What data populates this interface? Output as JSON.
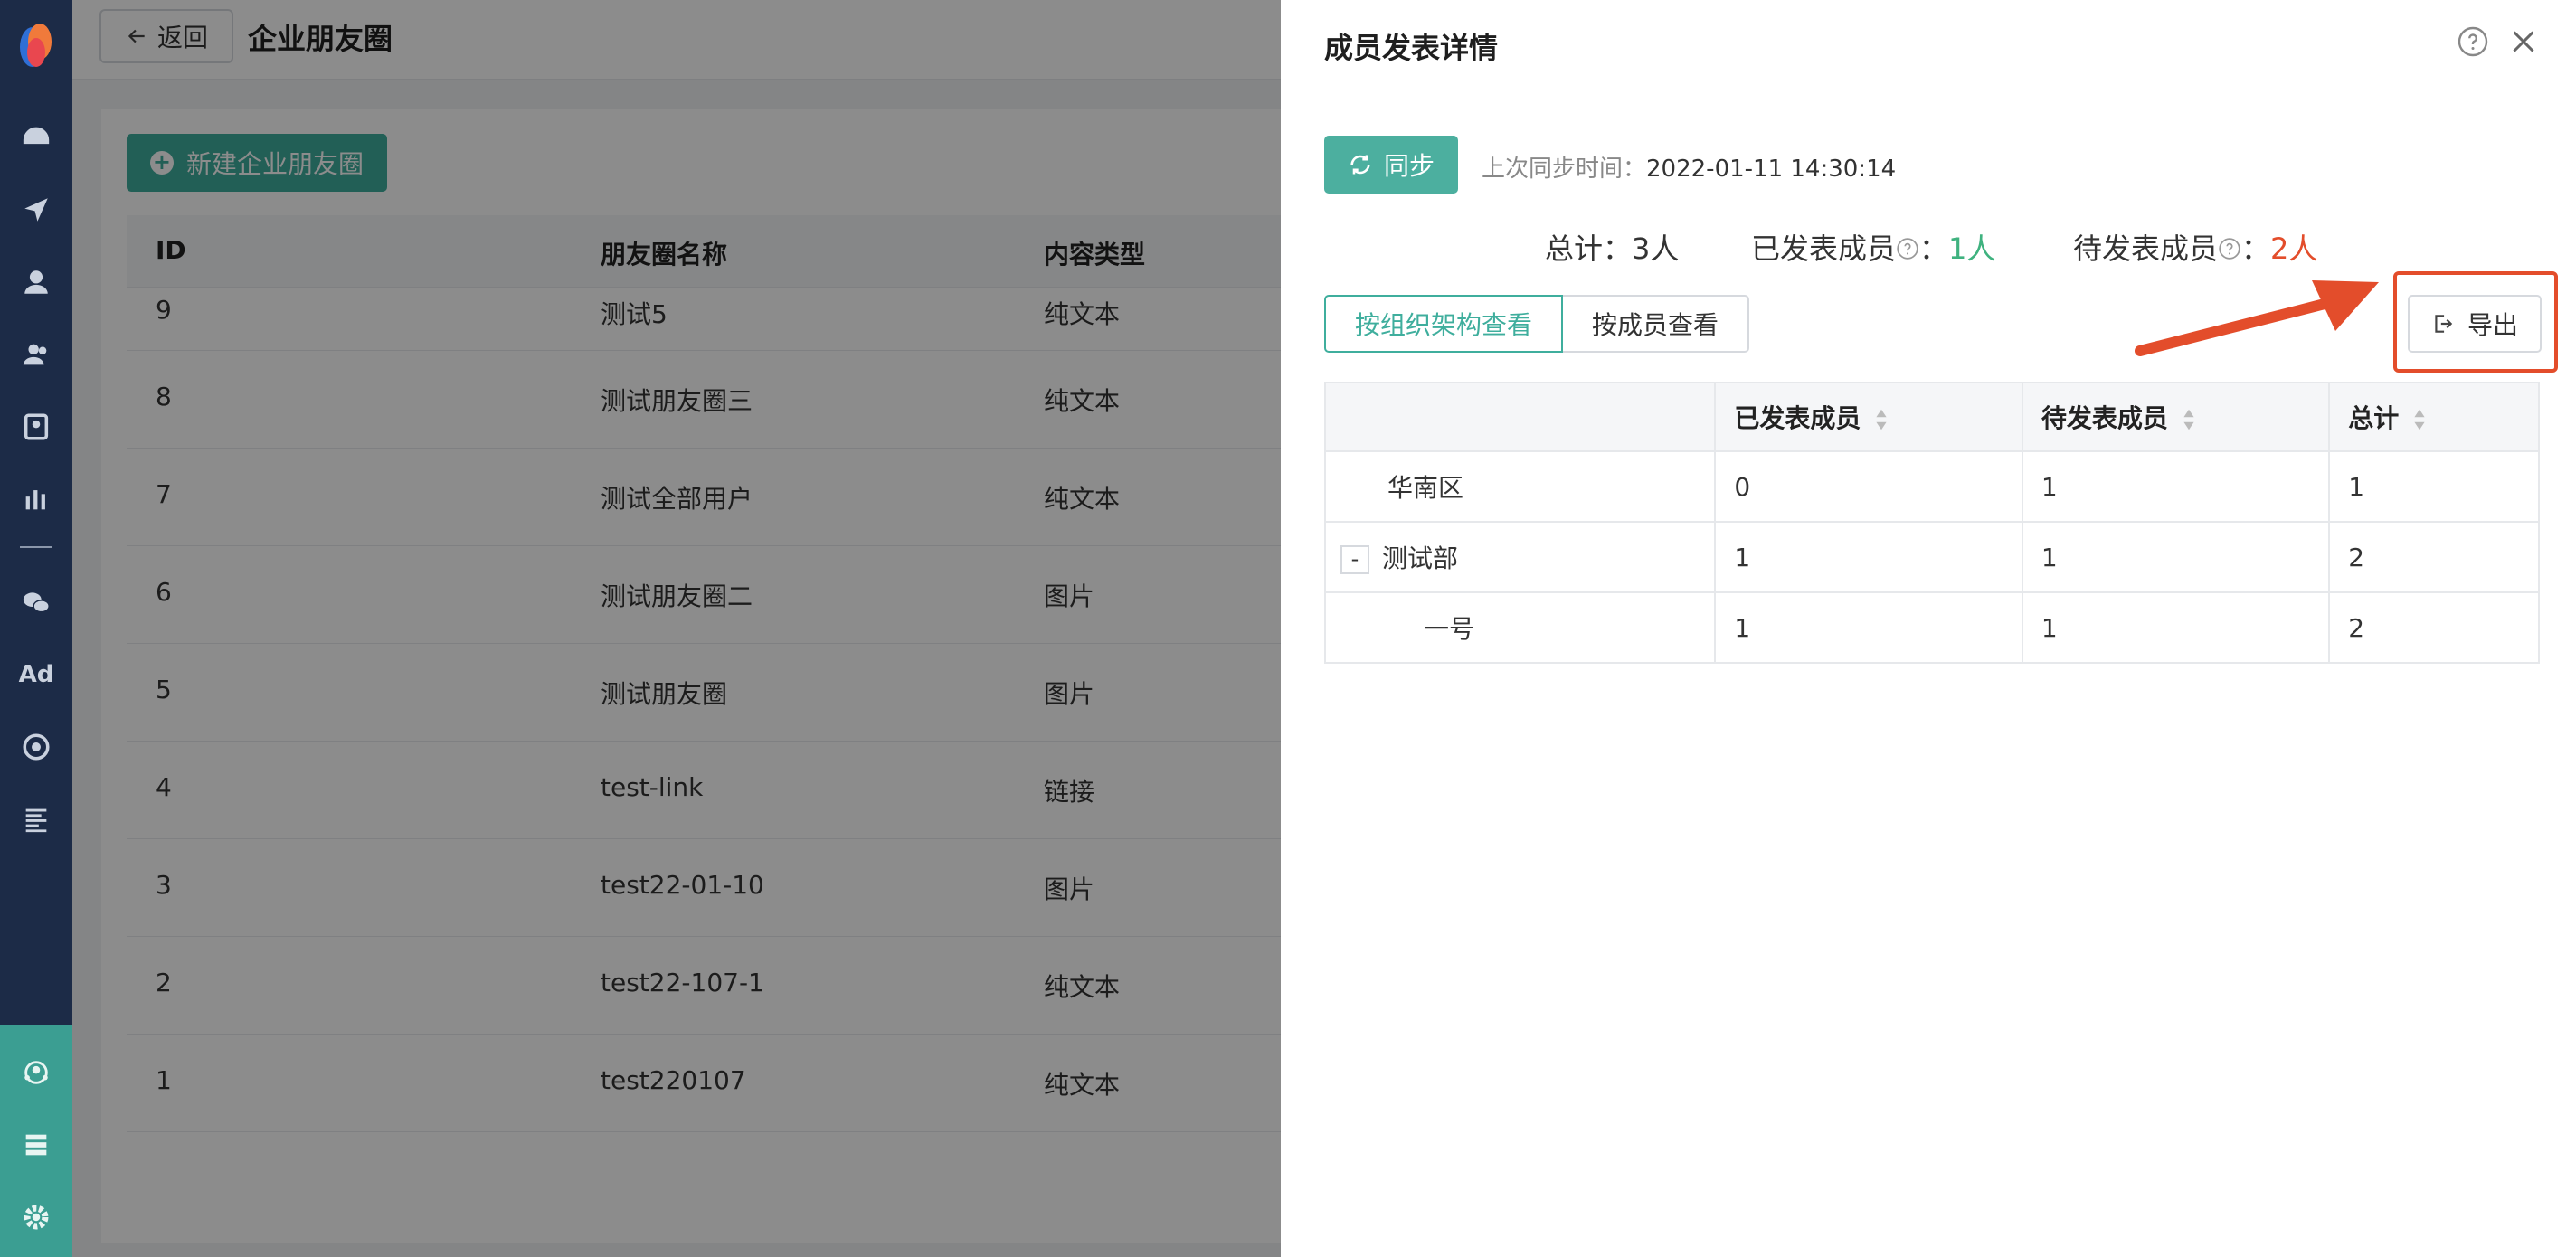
{
  "topbar": {
    "back_label": "返回",
    "page_title": "企业朋友圈"
  },
  "content": {
    "new_button_label": "新建企业朋友圈",
    "columns": [
      "ID",
      "朋友圈名称",
      "内容类型"
    ],
    "rows": [
      {
        "id": "9",
        "name": "测试5",
        "type": "纯文本"
      },
      {
        "id": "8",
        "name": "测试朋友圈三",
        "type": "纯文本"
      },
      {
        "id": "7",
        "name": "测试全部用户",
        "type": "纯文本"
      },
      {
        "id": "6",
        "name": "测试朋友圈二",
        "type": "图片"
      },
      {
        "id": "5",
        "name": "测试朋友圈",
        "type": "图片"
      },
      {
        "id": "4",
        "name": "test-link",
        "type": "链接"
      },
      {
        "id": "3",
        "name": "test22-01-10",
        "type": "图片"
      },
      {
        "id": "2",
        "name": "test22-107-1",
        "type": "纯文本"
      },
      {
        "id": "1",
        "name": "test220107",
        "type": "纯文本"
      }
    ]
  },
  "drawer": {
    "title": "成员发表详情",
    "sync_label": "同步",
    "sync_time_label": "上次同步时间：",
    "sync_time_value": "2022-01-11 14:30:14",
    "stats": {
      "total_label": "总计：",
      "total_value": "3人",
      "posted_label": "已发表成员",
      "posted_value": "1人",
      "pending_label": "待发表成员",
      "pending_value": "2人",
      "colon": "："
    },
    "view_org_label": "按组织架构查看",
    "view_member_label": "按成员查看",
    "export_label": "导出",
    "table": {
      "headers": [
        "",
        "已发表成员",
        "待发表成员",
        "总计"
      ],
      "rows": [
        {
          "name": "华南区",
          "posted": "0",
          "pending": "1",
          "total": "1"
        },
        {
          "name": "测试部",
          "toggle": "-",
          "posted": "1",
          "pending": "1",
          "total": "2"
        },
        {
          "name": "一号",
          "posted": "1",
          "pending": "1",
          "total": "2"
        }
      ]
    }
  },
  "colors": {
    "accent": "#3fae9d",
    "sidebar": "#1c2b47",
    "highlight": "#e34d2b",
    "posted": "#3fb27f"
  }
}
